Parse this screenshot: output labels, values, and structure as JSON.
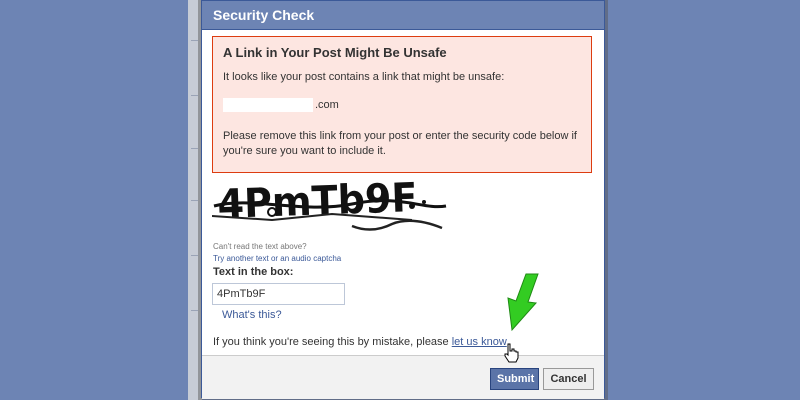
{
  "dialog": {
    "title": "Security Check"
  },
  "warning": {
    "heading": "A Link in Your Post Might Be Unsafe",
    "line1": "It looks like your post contains a link that might be unsafe:",
    "url_suffix": ".com",
    "line2": "Please remove this link from your post or enter the security code below if you're sure you want to include it."
  },
  "captcha": {
    "image_text": "4PmTb9F",
    "cant_read": "Can't read the text above?",
    "try_another": "Try another text or an audio captcha",
    "label": "Text in the box:",
    "input_value": "4PmTb9F",
    "whats_this": "What's this?"
  },
  "mistake": {
    "text": "If you think you're seeing this by mistake, please ",
    "link": "let us know"
  },
  "buttons": {
    "submit": "Submit",
    "cancel": "Cancel"
  },
  "colors": {
    "page_bg": "#6d84b4",
    "titlebar": "#6d84b4",
    "warning_bg": "#fde6e1",
    "warning_border": "#dd3c10",
    "link": "#3b5998",
    "annotation_arrow": "#33cc22"
  },
  "icons": [
    "pointer-hand-icon",
    "green-arrow-icon"
  ]
}
